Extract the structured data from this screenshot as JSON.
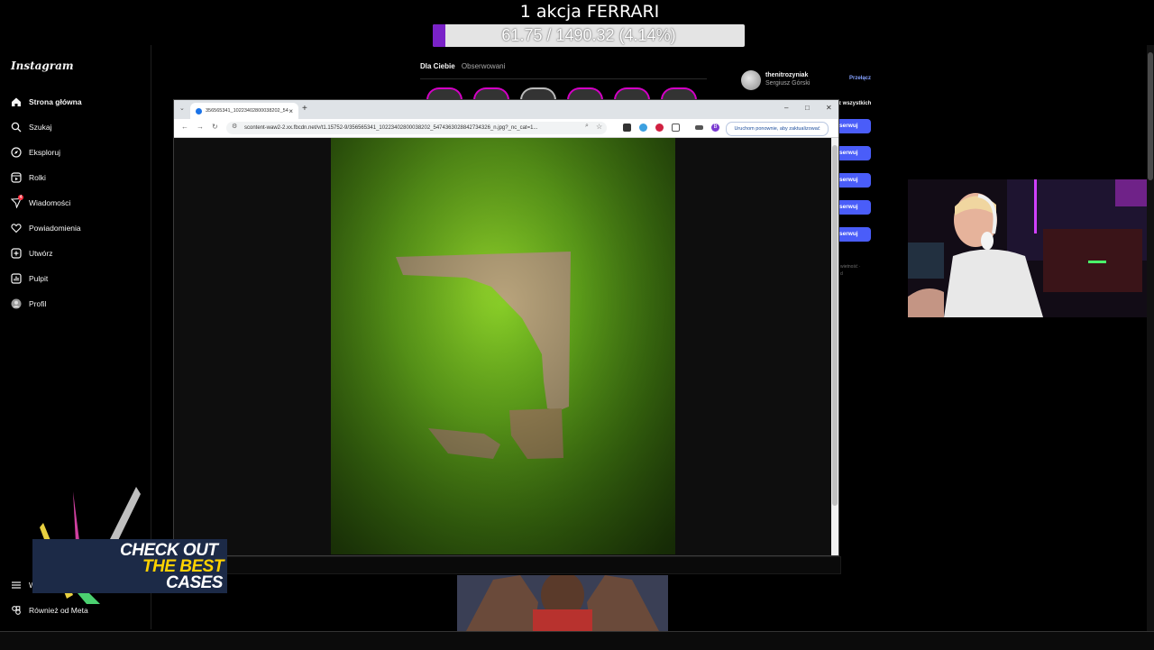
{
  "goal": {
    "title": "1 akcja FERRARI",
    "progress_text": "61.75 / 1490.32 (4.14%)",
    "progress_fraction": 0.0414,
    "fill_color": "#7a22c8"
  },
  "instagram": {
    "logo": "Instagram",
    "nav": [
      {
        "label": "Strona główna",
        "icon": "home-icon",
        "active": true
      },
      {
        "label": "Szukaj",
        "icon": "search-icon"
      },
      {
        "label": "Eksploruj",
        "icon": "compass-icon"
      },
      {
        "label": "Rolki",
        "icon": "reels-icon"
      },
      {
        "label": "Wiadomości",
        "icon": "messenger-icon",
        "badge": "4"
      },
      {
        "label": "Powiadomienia",
        "icon": "heart-icon"
      },
      {
        "label": "Utwórz",
        "icon": "plus-square-icon"
      },
      {
        "label": "Pulpit",
        "icon": "dashboard-icon"
      },
      {
        "label": "Profil",
        "icon": "profile-avatar-icon"
      }
    ],
    "more_label": "W",
    "meta_label": "Również od Meta",
    "feed_tabs": {
      "for_you": "Dla Ciebie",
      "following": "Obserwowani"
    },
    "suggestions": {
      "username": "thenitrozyniak",
      "full_name": "Sergiusz Górski",
      "switch_label": "Przełącz",
      "see_all": "z wszystkich",
      "follow_label": "serwuj",
      "footer_fragment": "wietność ·\nd"
    }
  },
  "browser": {
    "tab_title": "356565341_10223402800038202_5474363028842734326_n.jpg",
    "url": "scontent-waw2-2.xx.fbcdn.net/v/t1.15752-9/356565341_10223402800038202_5474363028842734326_n.jpg?_nc_cat=1...",
    "restart_label": "Uruchom ponownie, aby zaktualizować",
    "profile_letter": "B",
    "accent_color": "#1a73e8"
  },
  "ad": {
    "line1": "CHECK OUT",
    "line2": "THE BEST",
    "line3": "CASES"
  }
}
